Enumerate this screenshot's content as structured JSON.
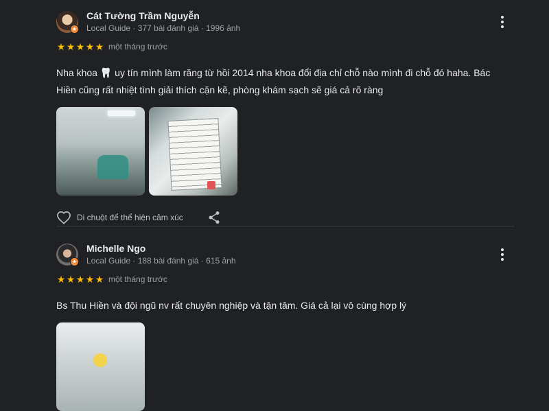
{
  "reviews": [
    {
      "author": "Cát Tường Trầm Nguyễn",
      "meta": "Local Guide · 377 bài đánh giá · 1996 ảnh",
      "rating": 5,
      "time": "một tháng trước",
      "text_part1": "Nha khoa ",
      "tooth_emoji": "🦷",
      "text_part2": " uy tín mình làm răng từ hồi 2014 nha khoa đổi địa chỉ chỗ nào mình đi chỗ đó haha. Bác Hiền cũng rất nhiệt tình giải thích cặn kẽ, phòng khám sạch sẽ giá cả rõ ràng",
      "like_label": "Di chuột để thể hiện cảm xúc"
    },
    {
      "author": "Michelle Ngo",
      "meta": "Local Guide · 188 bài đánh giá · 615 ảnh",
      "rating": 5,
      "time": "một tháng trước",
      "text": "Bs Thu Hiền và đội ngũ nv rất chuyên nghiệp và tận tâm. Giá cả lại vô cùng hợp lý"
    }
  ],
  "colors": {
    "background": "#202124",
    "star": "#fbbc04",
    "guide_badge": "#f28b39",
    "divider": "#3c4043"
  },
  "icons": {
    "more": "more-vert-icon",
    "like": "heart-outline-icon",
    "share": "share-icon",
    "star": "star-icon",
    "guide": "local-guide-badge-icon"
  }
}
